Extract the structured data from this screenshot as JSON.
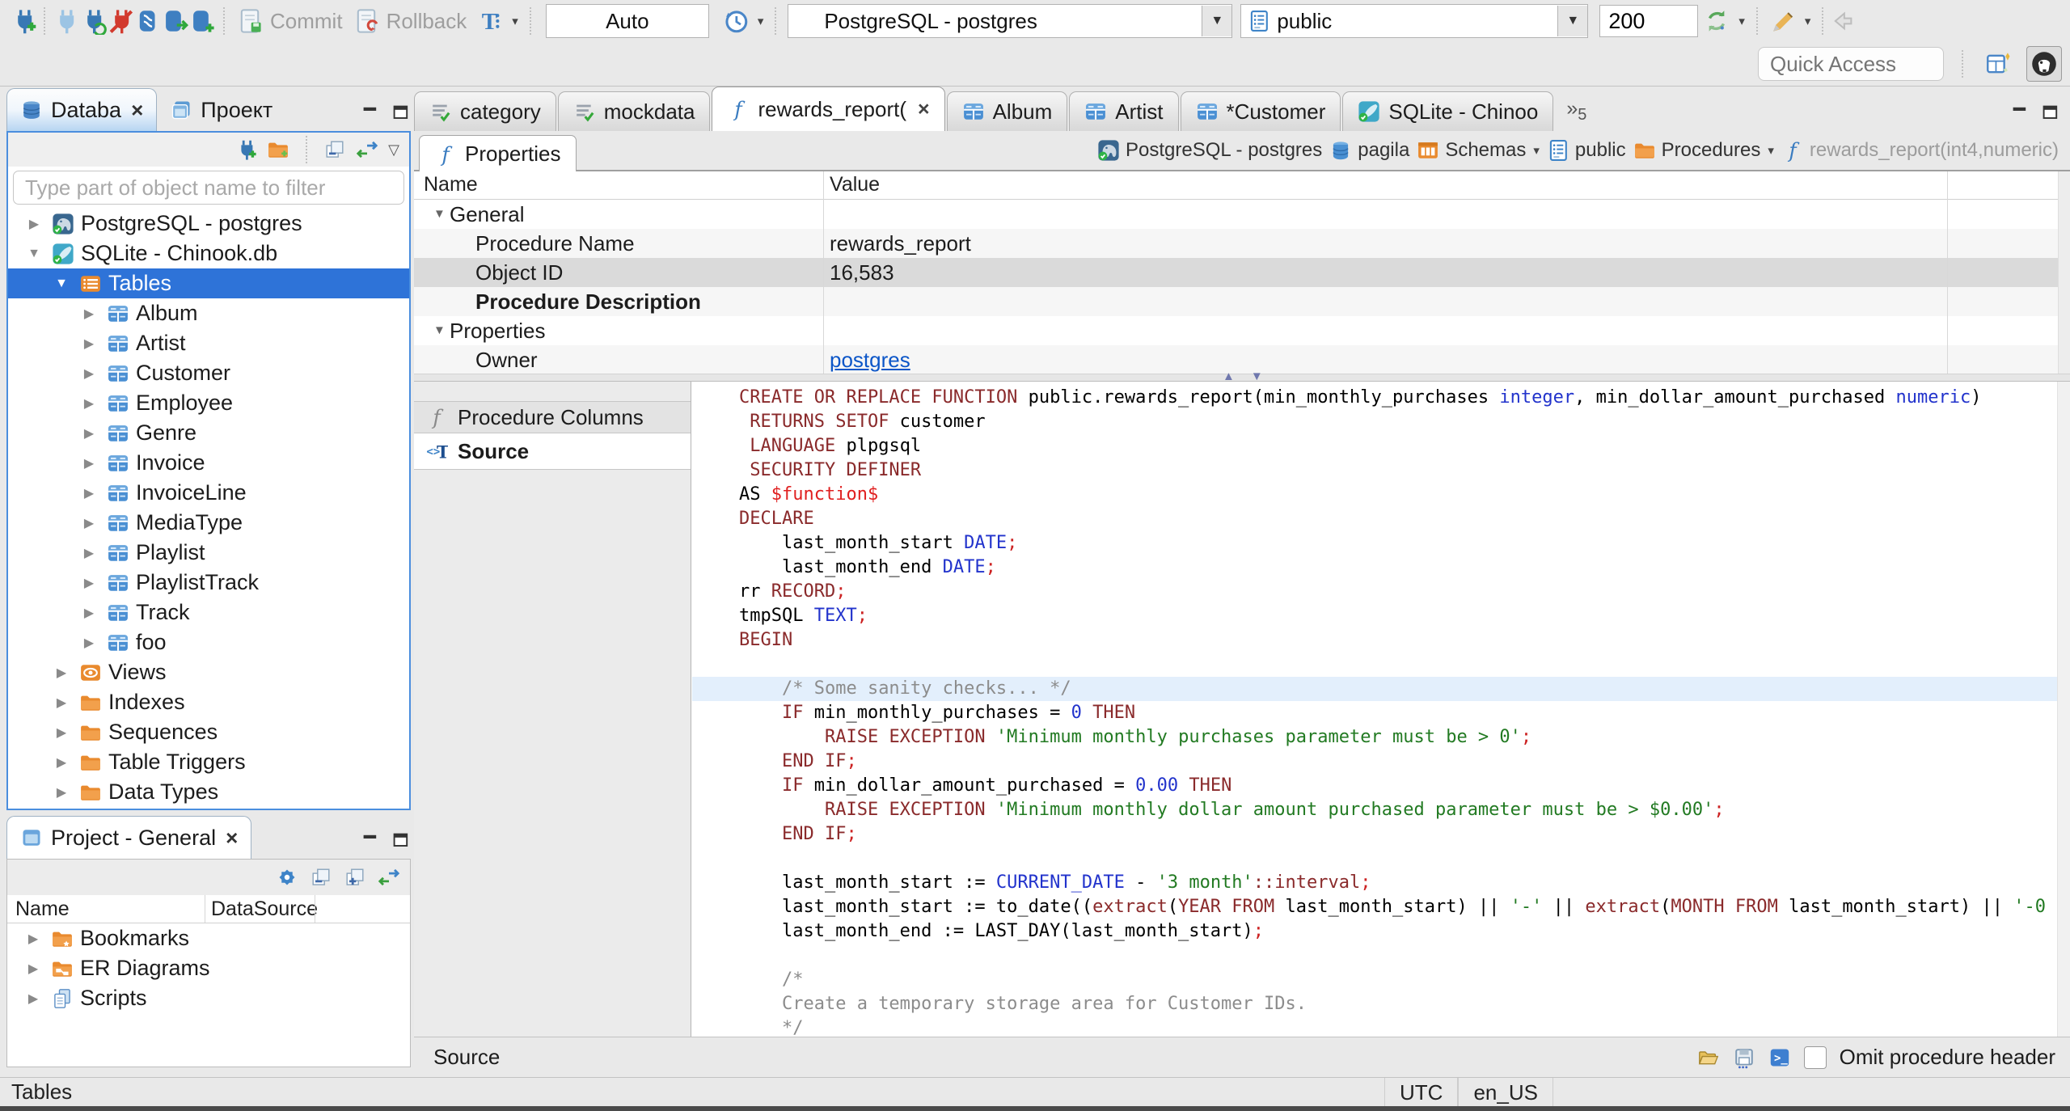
{
  "toolbar": {
    "commit_label": "Commit",
    "rollback_label": "Rollback",
    "auto_label": "Auto",
    "connection": "PostgreSQL - postgres",
    "schema": "public",
    "fetch_size": "200",
    "quick_access_placeholder": "Quick Access"
  },
  "left": {
    "tabs": [
      {
        "label": "Databa"
      },
      {
        "label": "Проект"
      }
    ],
    "filter_placeholder": "Type part of object name to filter",
    "tree": [
      {
        "label": "PostgreSQL - postgres",
        "icon": "postgres",
        "level": 0,
        "arrow": "collapsed"
      },
      {
        "label": "SQLite - Chinook.db",
        "icon": "sqlite",
        "level": 0,
        "arrow": "expanded"
      },
      {
        "label": "Tables",
        "icon": "tables",
        "level": 1,
        "arrow": "expanded",
        "selected": true
      },
      {
        "label": "Album",
        "icon": "table",
        "level": 2,
        "arrow": "collapsed"
      },
      {
        "label": "Artist",
        "icon": "table",
        "level": 2,
        "arrow": "collapsed"
      },
      {
        "label": "Customer",
        "icon": "table",
        "level": 2,
        "arrow": "collapsed"
      },
      {
        "label": "Employee",
        "icon": "table",
        "level": 2,
        "arrow": "collapsed"
      },
      {
        "label": "Genre",
        "icon": "table",
        "level": 2,
        "arrow": "collapsed"
      },
      {
        "label": "Invoice",
        "icon": "table",
        "level": 2,
        "arrow": "collapsed"
      },
      {
        "label": "InvoiceLine",
        "icon": "table",
        "level": 2,
        "arrow": "collapsed"
      },
      {
        "label": "MediaType",
        "icon": "table",
        "level": 2,
        "arrow": "collapsed"
      },
      {
        "label": "Playlist",
        "icon": "table",
        "level": 2,
        "arrow": "collapsed"
      },
      {
        "label": "PlaylistTrack",
        "icon": "table",
        "level": 2,
        "arrow": "collapsed"
      },
      {
        "label": "Track",
        "icon": "table",
        "level": 2,
        "arrow": "collapsed"
      },
      {
        "label": "foo",
        "icon": "table",
        "level": 2,
        "arrow": "collapsed"
      },
      {
        "label": "Views",
        "icon": "views",
        "level": 1,
        "arrow": "collapsed"
      },
      {
        "label": "Indexes",
        "icon": "folder",
        "level": 1,
        "arrow": "collapsed"
      },
      {
        "label": "Sequences",
        "icon": "folder",
        "level": 1,
        "arrow": "collapsed"
      },
      {
        "label": "Table Triggers",
        "icon": "folder",
        "level": 1,
        "arrow": "collapsed"
      },
      {
        "label": "Data Types",
        "icon": "folder",
        "level": 1,
        "arrow": "collapsed"
      }
    ]
  },
  "project_panel": {
    "title": "Project - General",
    "columns": [
      "Name",
      "DataSource"
    ],
    "items": [
      {
        "label": "Bookmarks",
        "icon": "folder-bookmarks"
      },
      {
        "label": "ER Diagrams",
        "icon": "folder-er"
      },
      {
        "label": "Scripts",
        "icon": "scripts"
      }
    ]
  },
  "editor": {
    "tabs": [
      {
        "label": "category",
        "icon": "sql-script"
      },
      {
        "label": "mockdata",
        "icon": "sql-script"
      },
      {
        "label": "rewards_report(",
        "icon": "function",
        "active": true,
        "closable": true
      },
      {
        "label": "Album",
        "icon": "table"
      },
      {
        "label": "Artist",
        "icon": "table"
      },
      {
        "label": "*Customer",
        "icon": "table"
      },
      {
        "label": "SQLite - Chinoo",
        "icon": "sqlite"
      }
    ],
    "overflow_count": "5",
    "subtab": "Properties",
    "breadcrumb": [
      {
        "label": "PostgreSQL - postgres",
        "icon": "postgres"
      },
      {
        "label": "pagila",
        "icon": "database"
      },
      {
        "label": "Schemas",
        "icon": "schemas",
        "dropdown": true
      },
      {
        "label": "public",
        "icon": "schema"
      },
      {
        "label": "Procedures",
        "icon": "folder",
        "dropdown": true
      },
      {
        "label": "rewards_report(int4,numeric)",
        "icon": "function",
        "muted": true
      }
    ],
    "properties": {
      "columns": [
        "Name",
        "Value"
      ],
      "rows": [
        {
          "name": "General",
          "group": true
        },
        {
          "name": "Procedure Name",
          "value": "rewards_report",
          "stripe": true
        },
        {
          "name": "Object ID",
          "value": "16,583",
          "selected": true
        },
        {
          "name": "Procedure Description",
          "bold": true,
          "value": "",
          "stripe": true
        },
        {
          "name": "Properties",
          "group": true
        },
        {
          "name": "Owner",
          "value": "postgres",
          "link": true,
          "stripe": true
        }
      ]
    },
    "side_tabs": [
      {
        "label": "Procedure Columns",
        "icon": "function-gray"
      },
      {
        "label": "Source",
        "icon": "source",
        "active": true
      }
    ],
    "footer": {
      "label": "Source",
      "checkbox_label": "Omit procedure header"
    }
  },
  "source_code": {
    "lines": [
      {
        "tokens": [
          [
            "kw",
            "CREATE OR REPLACE FUNCTION"
          ],
          [
            "pl",
            " public.rewards_report(min_monthly_purchases "
          ],
          [
            "ty",
            "integer"
          ],
          [
            "pl",
            ", min_dollar_amount_purchased "
          ],
          [
            "ty",
            "numeric"
          ],
          [
            "pl",
            ")"
          ]
        ]
      },
      {
        "tokens": [
          [
            "pl",
            " "
          ],
          [
            "kw",
            "RETURNS SETOF"
          ],
          [
            "pl",
            " customer"
          ]
        ]
      },
      {
        "tokens": [
          [
            "pl",
            " "
          ],
          [
            "kw",
            "LANGUAGE"
          ],
          [
            "pl",
            " plpgsql"
          ]
        ]
      },
      {
        "tokens": [
          [
            "pl",
            " "
          ],
          [
            "kw",
            "SECURITY DEFINER"
          ]
        ]
      },
      {
        "tokens": [
          [
            "pl",
            "AS "
          ],
          [
            "dl",
            "$function$"
          ]
        ]
      },
      {
        "tokens": [
          [
            "kw",
            "DECLARE"
          ]
        ]
      },
      {
        "tokens": [
          [
            "pl",
            "    last_month_start "
          ],
          [
            "ty",
            "DATE"
          ],
          [
            "pu",
            ";"
          ]
        ]
      },
      {
        "tokens": [
          [
            "pl",
            "    last_month_end "
          ],
          [
            "ty",
            "DATE"
          ],
          [
            "pu",
            ";"
          ]
        ]
      },
      {
        "tokens": [
          [
            "pl",
            "rr "
          ],
          [
            "kw",
            "RECORD"
          ],
          [
            "pu",
            ";"
          ]
        ]
      },
      {
        "tokens": [
          [
            "pl",
            "tmpSQL "
          ],
          [
            "ty",
            "TEXT"
          ],
          [
            "pu",
            ";"
          ]
        ]
      },
      {
        "tokens": [
          [
            "kw",
            "BEGIN"
          ]
        ]
      },
      {
        "tokens": []
      },
      {
        "highlight": true,
        "tokens": [
          [
            "pl",
            "    "
          ],
          [
            "cm",
            "/* Some sanity checks... */"
          ]
        ]
      },
      {
        "tokens": [
          [
            "pl",
            "    "
          ],
          [
            "kw",
            "IF"
          ],
          [
            "pl",
            " min_monthly_purchases = "
          ],
          [
            "ty",
            "0"
          ],
          [
            "pl",
            " "
          ],
          [
            "kw",
            "THEN"
          ]
        ]
      },
      {
        "tokens": [
          [
            "pl",
            "        "
          ],
          [
            "kw",
            "RAISE EXCEPTION"
          ],
          [
            "pl",
            " "
          ],
          [
            "st",
            "'Minimum monthly purchases parameter must be > 0'"
          ],
          [
            "pu",
            ";"
          ]
        ]
      },
      {
        "tokens": [
          [
            "pl",
            "    "
          ],
          [
            "kw",
            "END IF"
          ],
          [
            "pu",
            ";"
          ]
        ]
      },
      {
        "tokens": [
          [
            "pl",
            "    "
          ],
          [
            "kw",
            "IF"
          ],
          [
            "pl",
            " min_dollar_amount_purchased = "
          ],
          [
            "ty",
            "0.00"
          ],
          [
            "pl",
            " "
          ],
          [
            "kw",
            "THEN"
          ]
        ]
      },
      {
        "tokens": [
          [
            "pl",
            "        "
          ],
          [
            "kw",
            "RAISE EXCEPTION"
          ],
          [
            "pl",
            " "
          ],
          [
            "st",
            "'Minimum monthly dollar amount purchased parameter must be > $0.00'"
          ],
          [
            "pu",
            ";"
          ]
        ]
      },
      {
        "tokens": [
          [
            "pl",
            "    "
          ],
          [
            "kw",
            "END IF"
          ],
          [
            "pu",
            ";"
          ]
        ]
      },
      {
        "tokens": []
      },
      {
        "tokens": [
          [
            "pl",
            "    last_month_start := "
          ],
          [
            "ty",
            "CURRENT_DATE"
          ],
          [
            "pl",
            " - "
          ],
          [
            "st",
            "'3 month'"
          ],
          [
            "kw",
            "::interval"
          ],
          [
            "pu",
            ";"
          ]
        ]
      },
      {
        "tokens": [
          [
            "pl",
            "    last_month_start := to_date(("
          ],
          [
            "kw",
            "extract"
          ],
          [
            "pl",
            "("
          ],
          [
            "kw",
            "YEAR FROM"
          ],
          [
            "pl",
            " last_month_start) || "
          ],
          [
            "st",
            "'-'"
          ],
          [
            "pl",
            " || "
          ],
          [
            "kw",
            "extract"
          ],
          [
            "pl",
            "("
          ],
          [
            "kw",
            "MONTH FROM"
          ],
          [
            "pl",
            " last_month_start) || "
          ],
          [
            "st",
            "'-0"
          ]
        ]
      },
      {
        "tokens": [
          [
            "pl",
            "    last_month_end := LAST_DAY(last_month_start)"
          ],
          [
            "pu",
            ";"
          ]
        ]
      },
      {
        "tokens": []
      },
      {
        "tokens": [
          [
            "pl",
            "    "
          ],
          [
            "cm",
            "/*"
          ]
        ]
      },
      {
        "tokens": [
          [
            "pl",
            "    "
          ],
          [
            "cm",
            "Create a temporary storage area for Customer IDs."
          ]
        ]
      },
      {
        "tokens": [
          [
            "pl",
            "    "
          ],
          [
            "cm",
            "*/"
          ]
        ]
      }
    ]
  },
  "statusbar": {
    "left": "Tables",
    "timezone": "UTC",
    "locale": "en_US"
  }
}
